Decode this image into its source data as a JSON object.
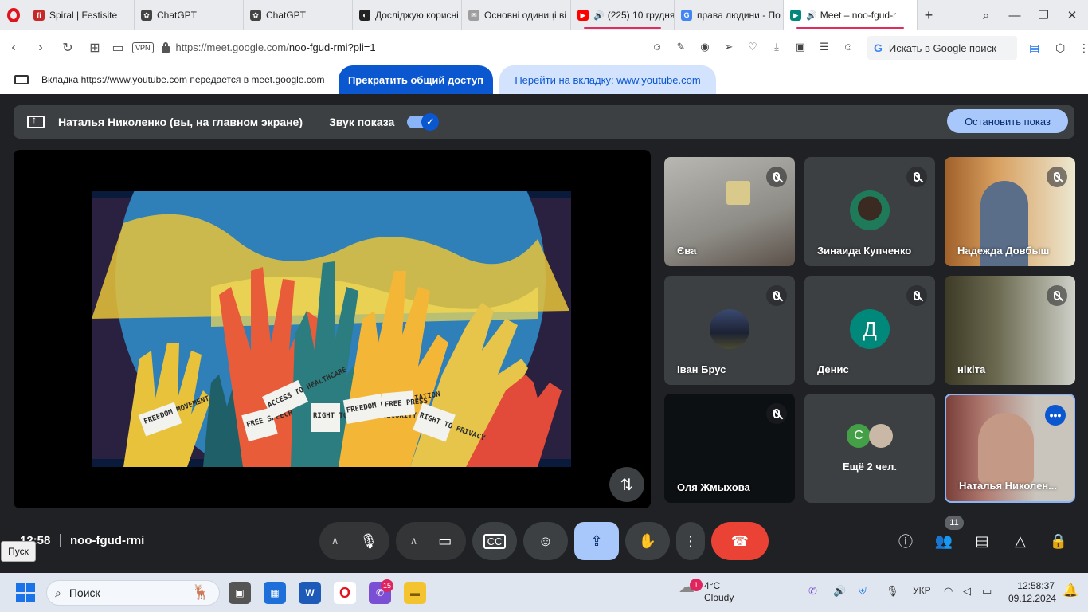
{
  "browser": {
    "tabs": [
      {
        "title": "Spiral | Festisite",
        "fav_color": "#c62828",
        "fav_text": "fi"
      },
      {
        "title": "ChatGPT",
        "fav_color": "#444444",
        "fav_text": "✿"
      },
      {
        "title": "ChatGPT",
        "fav_color": "#444444",
        "fav_text": "✿"
      },
      {
        "title": "Досліджую корисні",
        "fav_color": "#222222",
        "fav_text": "◐"
      },
      {
        "title": "Основні одиниці ві",
        "fav_color": "#9e9e9e",
        "fav_text": "✉"
      },
      {
        "title": "(225) 10 грудня",
        "fav_color": "#ff0000",
        "fav_text": "▶"
      },
      {
        "title": "права людини - По",
        "fav_color": "#4285f4",
        "fav_text": "G"
      },
      {
        "title": "Meet – noo-fgud-r",
        "fav_color": "#00897b",
        "fav_text": "▶"
      }
    ],
    "url_prefix": "https://meet.google.com/",
    "url_path": "noo-fgud-rmi?pli=1",
    "vpn_label": "VPN",
    "search_box": "Искать в Google поиск"
  },
  "share_banner": {
    "text": "Вкладка https://www.youtube.com передается в meet.google.com",
    "stop_button": "Прекратить общий доступ",
    "goto_button": "Перейти на вкладку: www.youtube.com"
  },
  "presentation": {
    "presenter": "Наталья Николенко (вы, на главном экране)",
    "sound_label": "Звук показа",
    "stop_button": "Остановить показ"
  },
  "video_banners": [
    "FREEDOM MOVEMENT",
    "FREE SPEECH",
    "ACCESS TO HEALTHCARE",
    "RIGHT TO SOCIAL SECURITY",
    "FREEDOM OF ASSOCIATION",
    "FREE PRESS",
    "RIGHT TO PRIVACY"
  ],
  "participants": [
    {
      "name": "Єва",
      "muted": true,
      "avatar": ""
    },
    {
      "name": "Зинаида Купченко",
      "muted": true,
      "avatar": ""
    },
    {
      "name": "Надежда Довбыш",
      "muted": true,
      "avatar": ""
    },
    {
      "name": "Іван Брус",
      "muted": true,
      "avatar": ""
    },
    {
      "name": "Денис",
      "muted": true,
      "avatar": "Д"
    },
    {
      "name": "нікіта",
      "muted": true,
      "avatar": ""
    },
    {
      "name": "Оля Жмыхова",
      "muted": true,
      "avatar": ""
    },
    {
      "name": "Ещё 2 чел.",
      "muted": false,
      "avatar": "C"
    },
    {
      "name": "Наталья Николен...",
      "muted": false,
      "avatar": ""
    }
  ],
  "controls": {
    "time": "12:58",
    "meeting_code": "noo-fgud-rmi",
    "participants_count": "11"
  },
  "tooltip": "Пуск",
  "taskbar": {
    "search_placeholder": "Поиск",
    "weather_temp": "4°C",
    "weather_desc": "Cloudy",
    "weather_badge": "1",
    "viber_badge": "15",
    "lang": "УКР",
    "time": "12:58:37",
    "date": "09.12.2024"
  }
}
